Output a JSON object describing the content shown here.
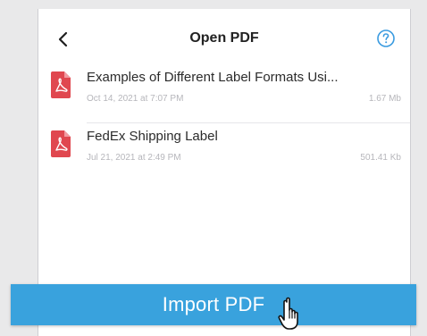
{
  "header": {
    "title": "Open PDF",
    "back_icon": "chevron-left-icon",
    "help_icon": "question-circle-icon"
  },
  "files": [
    {
      "name": "Examples of Different Label Formats Usi...",
      "date": "Oct 14, 2021 at 7:07 PM",
      "size": "1.67 Mb",
      "icon": "pdf-file-icon"
    },
    {
      "name": "FedEx Shipping Label",
      "date": "Jul 21, 2021 at 2:49 PM",
      "size": "501.41 Kb",
      "icon": "pdf-file-icon"
    }
  ],
  "import_button": {
    "label": "Import PDF"
  },
  "colors": {
    "accent": "#39a2dd",
    "pdf_red": "#e0474f"
  }
}
